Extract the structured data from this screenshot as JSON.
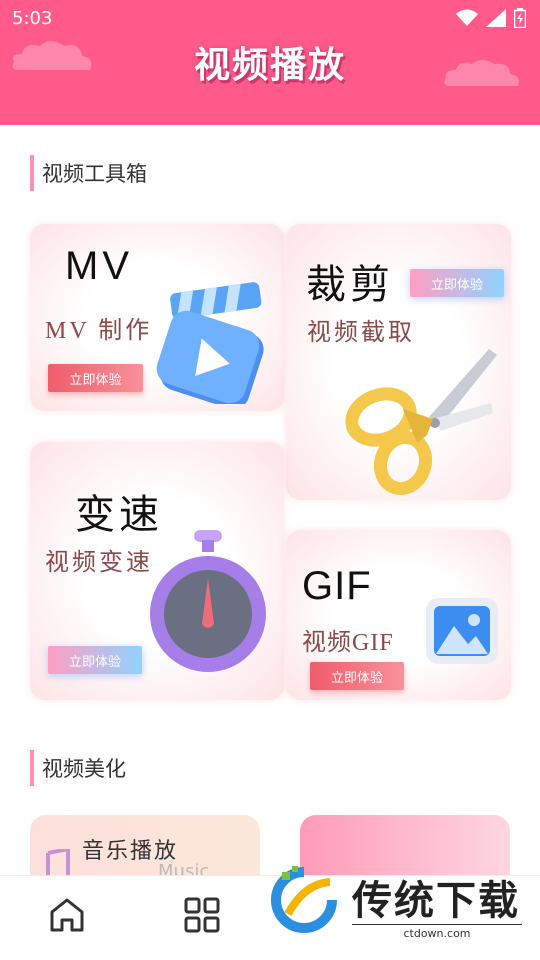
{
  "status_bar": {
    "time": "5:03"
  },
  "header": {
    "title": "视频播放",
    "bg_color": "#ff5a8a"
  },
  "sections": [
    {
      "label": "视频工具箱"
    },
    {
      "label": "视频美化"
    }
  ],
  "tools": {
    "mv": {
      "title": "MV",
      "subtitle": "MV 制作",
      "button": "立即体验",
      "icon": "clapperboard-icon"
    },
    "cut": {
      "title": "裁剪",
      "subtitle": "视频截取",
      "button": "立即体验",
      "icon": "scissors-icon"
    },
    "speed": {
      "title": "变速",
      "subtitle": "视频变速",
      "button": "立即体验",
      "icon": "stopwatch-icon"
    },
    "gif": {
      "title": "GIF",
      "subtitle": "视频GIF",
      "button": "立即体验",
      "icon": "image-icon"
    }
  },
  "beautify": {
    "music": {
      "title": "音乐播放",
      "subtitle": "Music",
      "icon": "music-note-icon"
    }
  },
  "nav": [
    {
      "icon": "home-icon"
    },
    {
      "icon": "grid-icon"
    }
  ],
  "watermark": {
    "name": "传统下载",
    "url": "ctdown.com"
  }
}
